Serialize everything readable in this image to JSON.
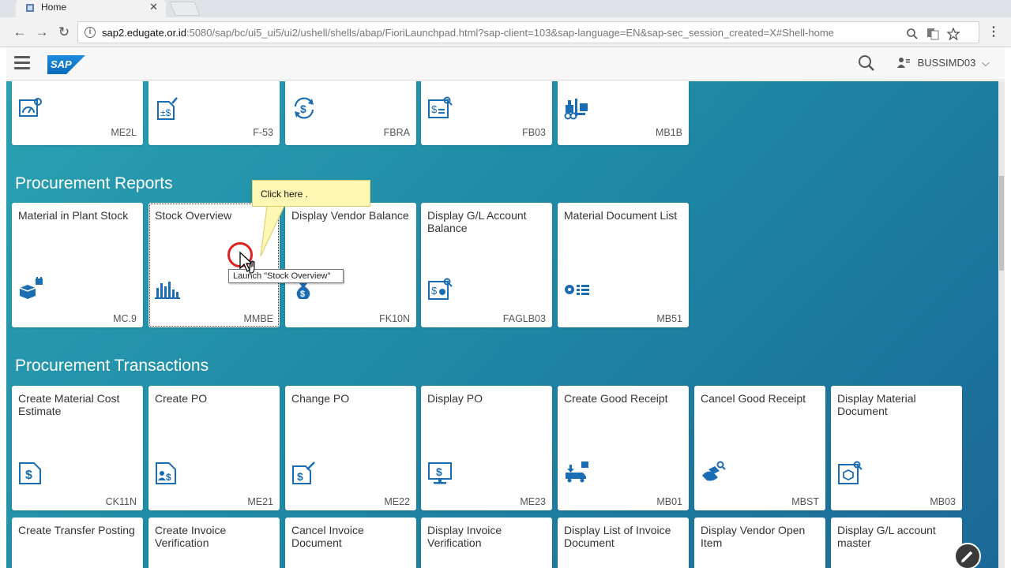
{
  "browser": {
    "tab_title": "Home",
    "tab_close": "✕",
    "url_host": "sap2.edugate.or.id",
    "url_rest": ":5080/sap/bc/ui5_ui5/ui2/ushell/shells/abap/FioriLaunchpad.html?sap-client=103&sap-language=EN&sap-sec_session_created=X#Shell-home",
    "nav_back": "←",
    "nav_forward": "→",
    "nav_reload": "↻",
    "menu": "⋮"
  },
  "shell": {
    "logo": "SAP",
    "username": "BUSSIMD03",
    "user_chevron": "⌵"
  },
  "top_tiles": [
    {
      "code": "ME2L",
      "icon": "gauge-doc-icon"
    },
    {
      "code": "F-53",
      "icon": "doc-dollar-icon"
    },
    {
      "code": "FBRA",
      "icon": "dollar-cycle-icon"
    },
    {
      "code": "FB03",
      "icon": "doc-search-icon"
    },
    {
      "code": "MB1B",
      "icon": "forklift-icon"
    }
  ],
  "reports": {
    "title": "Procurement Reports",
    "tiles": [
      {
        "title": "Material in Plant Stock",
        "code": "MC.9",
        "icon": "box-calendar-icon"
      },
      {
        "title": "Stock Overview",
        "code": "MMBE",
        "icon": "bar-chart-icon"
      },
      {
        "title": "Display Vendor Balance",
        "code": "FK10N",
        "icon": "money-bag-icon"
      },
      {
        "title": "Display G/L Account Balance",
        "code": "FAGLB03",
        "icon": "doc-search-icon"
      },
      {
        "title": "Material Document List",
        "code": "MB51",
        "icon": "list-icon"
      }
    ]
  },
  "transactions": {
    "title": "Procurement Transactions",
    "tiles": [
      {
        "title": "Create Material Cost Estimate",
        "code": "CK11N",
        "icon": "doc-dollar-icon"
      },
      {
        "title": "Create PO",
        "code": "ME21",
        "icon": "doc-person-dollar-icon"
      },
      {
        "title": "Change PO",
        "code": "ME22",
        "icon": "doc-dollar-edit-icon"
      },
      {
        "title": "Display PO",
        "code": "ME23",
        "icon": "monitor-dollar-icon"
      },
      {
        "title": "Create Good Receipt",
        "code": "MB01",
        "icon": "truck-icon"
      },
      {
        "title": "Cancel Good Receipt",
        "code": "MBST",
        "icon": "hand-search-icon"
      },
      {
        "title": "Display Material Document",
        "code": "MB03",
        "icon": "doc-box-search-icon"
      }
    ],
    "tiles_row2": [
      {
        "title": "Create Transfer Posting"
      },
      {
        "title": "Create Invoice Verification"
      },
      {
        "title": "Cancel Invoice Document"
      },
      {
        "title": "Display Invoice Verification"
      },
      {
        "title": "Display List of Invoice Document"
      },
      {
        "title": "Display Vendor Open Item"
      },
      {
        "title": "Display G/L account master"
      }
    ]
  },
  "overlay": {
    "callout": "Click here .",
    "tooltip": "Launch \"Stock Overview\""
  },
  "colors": {
    "icon_blue": "#1b6db3",
    "bg_start": "#2aa0b2",
    "bg_end": "#1b6896",
    "callout_bg": "#fff8b5"
  }
}
